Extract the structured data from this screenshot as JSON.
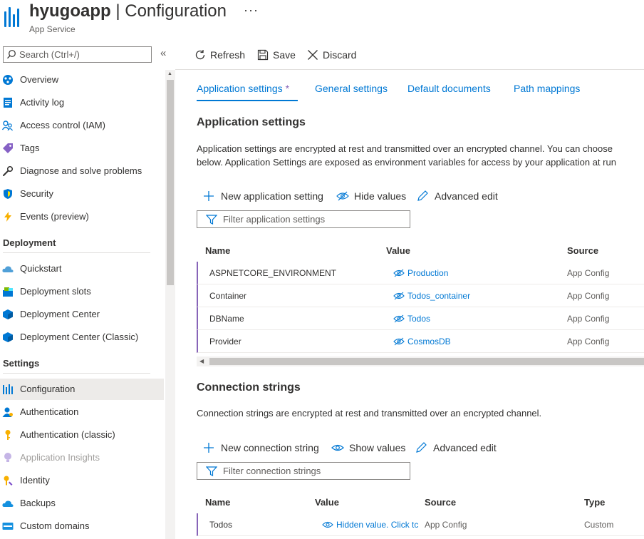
{
  "header": {
    "app_name": "hyugoapp",
    "separator": " | ",
    "page": "Configuration",
    "more": "···",
    "subtitle": "App Service"
  },
  "sidebar": {
    "search_placeholder": "Search (Ctrl+/)",
    "collapse": "«",
    "items": [
      {
        "label": "Overview",
        "icon": "overview-icon"
      },
      {
        "label": "Activity log",
        "icon": "activity-log-icon"
      },
      {
        "label": "Access control (IAM)",
        "icon": "access-control-icon"
      },
      {
        "label": "Tags",
        "icon": "tag-icon"
      },
      {
        "label": "Diagnose and solve problems",
        "icon": "wrench-icon"
      },
      {
        "label": "Security",
        "icon": "shield-icon"
      },
      {
        "label": "Events (preview)",
        "icon": "lightning-icon"
      }
    ],
    "deployment_header": "Deployment",
    "deployment_items": [
      {
        "label": "Quickstart",
        "icon": "cloud-icon"
      },
      {
        "label": "Deployment slots",
        "icon": "slots-icon"
      },
      {
        "label": "Deployment Center",
        "icon": "cube-icon"
      },
      {
        "label": "Deployment Center (Classic)",
        "icon": "cube-icon"
      }
    ],
    "settings_header": "Settings",
    "settings_items": [
      {
        "label": "Configuration",
        "icon": "configuration-icon",
        "active": true
      },
      {
        "label": "Authentication",
        "icon": "person-icon"
      },
      {
        "label": "Authentication (classic)",
        "icon": "key-icon"
      },
      {
        "label": "Application Insights",
        "icon": "lightbulb-icon",
        "disabled": true
      },
      {
        "label": "Identity",
        "icon": "key-icon"
      },
      {
        "label": "Backups",
        "icon": "cloud-backup-icon"
      },
      {
        "label": "Custom domains",
        "icon": "www-icon"
      }
    ]
  },
  "toolbar": {
    "refresh": "Refresh",
    "save": "Save",
    "discard": "Discard"
  },
  "tabs": {
    "app_settings": "Application settings",
    "app_settings_marker": "*",
    "general": "General settings",
    "default_docs": "Default documents",
    "path_mappings": "Path mappings"
  },
  "app_settings": {
    "title": "Application settings",
    "desc_line1": "Application settings are encrypted at rest and transmitted over an encrypted channel. You can choose",
    "desc_line2": "below. Application Settings are exposed as environment variables for access by your application at run",
    "new_label": "New application setting",
    "hide_label": "Hide values",
    "advanced_label": "Advanced edit",
    "filter_placeholder": "Filter application settings",
    "columns": {
      "name": "Name",
      "value": "Value",
      "source": "Source"
    },
    "rows": [
      {
        "name": "ASPNETCORE_ENVIRONMENT",
        "value": "Production",
        "source": "App Config"
      },
      {
        "name": "Container",
        "value": "Todos_container",
        "source": "App Config"
      },
      {
        "name": "DBName",
        "value": "Todos",
        "source": "App Config"
      },
      {
        "name": "Provider",
        "value": "CosmosDB",
        "source": "App Config"
      }
    ]
  },
  "conn_strings": {
    "title": "Connection strings",
    "desc": "Connection strings are encrypted at rest and transmitted over an encrypted channel.",
    "new_label": "New connection string",
    "show_label": "Show values",
    "advanced_label": "Advanced edit",
    "filter_placeholder": "Filter connection strings",
    "columns": {
      "name": "Name",
      "value": "Value",
      "source": "Source",
      "type": "Type"
    },
    "rows": [
      {
        "name": "Todos",
        "value": "Hidden value. Click tc",
        "source": "App Config",
        "type": "Custom"
      }
    ]
  },
  "colors": {
    "accent": "#0078d4",
    "modified": "#8764b8"
  }
}
